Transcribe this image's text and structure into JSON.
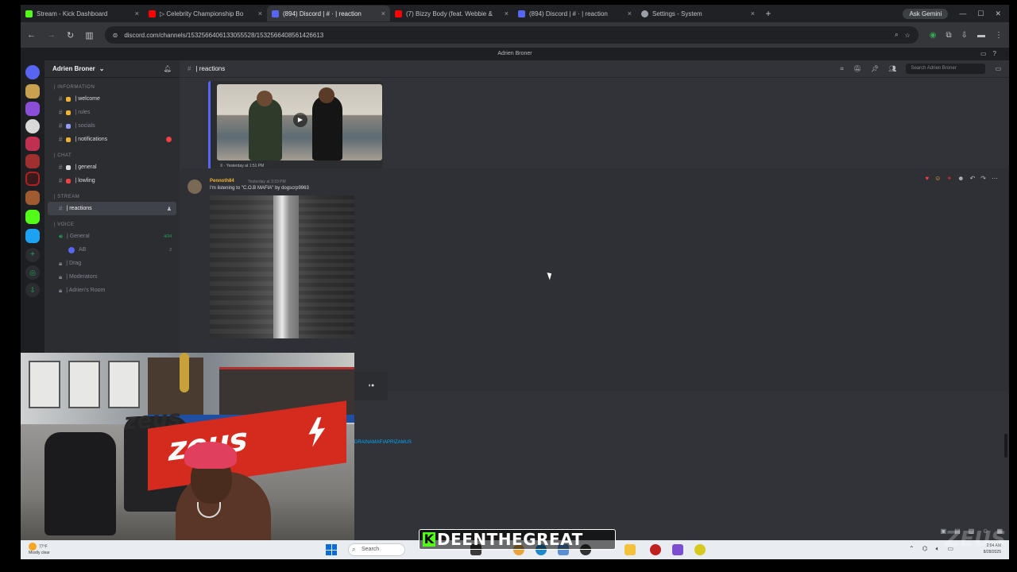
{
  "browser": {
    "tabs": [
      {
        "label": "Stream - Kick Dashboard",
        "icon_color": "#53fc18",
        "active": false
      },
      {
        "label": "▷ Celebrity Championship Bo",
        "icon_color": "#ff0000",
        "active": false
      },
      {
        "label": "(894) Discord | # · | reaction",
        "icon_color": "#5865f2",
        "active": true
      },
      {
        "label": "(7) Bizzy Body (feat. Webbie &",
        "icon_color": "#ff0000",
        "active": false
      },
      {
        "label": "(894) Discord | # · | reaction",
        "icon_color": "#5865f2",
        "active": false
      },
      {
        "label": "Settings - System",
        "icon_color": "#9aa0a6",
        "active": false
      }
    ],
    "new_tab": "+",
    "gemini_label": "Ask Gemini",
    "url": "discord.com/channels/1532566406133055528/1532566408561426613"
  },
  "discord": {
    "window_title": "Adrien Broner",
    "server_name": "Adrien Broner",
    "categories": {
      "information": "| INFORMATION",
      "chat": "| CHAT",
      "stream": "| STREAM",
      "voice": "| VOICE"
    },
    "channels_info": [
      {
        "label": "| welcome",
        "emoji_color": "#f0b232",
        "bright": true
      },
      {
        "label": "| rules",
        "emoji_color": "#f0b232",
        "bright": false
      },
      {
        "label": "| socials",
        "emoji_color": "#949cf7",
        "bright": false
      },
      {
        "label": "| notifications",
        "emoji_color": "#f0b232",
        "bright": true,
        "badge": true
      }
    ],
    "channels_chat": [
      {
        "label": "| general",
        "emoji_color": "#dbdee1",
        "bright": true
      },
      {
        "label": "| lowling",
        "emoji_color": "#f23f43",
        "bright": true
      }
    ],
    "channels_stream": [
      {
        "label": "| reactions",
        "selected": true
      }
    ],
    "channels_voice": [
      {
        "label": "| General",
        "count": "4/34"
      },
      {
        "label": "AB",
        "count": "2"
      },
      {
        "label": "| Drag"
      },
      {
        "label": "| Moderators"
      },
      {
        "label": "| Adrien's Room"
      }
    ],
    "current_channel": "| reactions",
    "search_placeholder": "Search Adrien Broner",
    "video_caption": "X · Yesterday at 1:51 PM",
    "message": {
      "author": "Pennoth84",
      "timestamp": "Yesterday at 3:33 PM",
      "text": "I'm listening to \"C.O.B MAFIA\" by dogscrp9963"
    },
    "link_text": "DRAINAMAFIAPRIZAMUS"
  },
  "taskbar": {
    "weather_temp": "77°F",
    "weather_desc": "Mostly clear",
    "search_label": "Search",
    "clock_time": "2:04 AM",
    "clock_date": "8/28/2025"
  },
  "overlay": {
    "k": "K",
    "name": "DEENTHEGREAT",
    "watermark": "ZEUS"
  },
  "webcam": {
    "banner_word": "zeus",
    "left_word": "zeus"
  }
}
